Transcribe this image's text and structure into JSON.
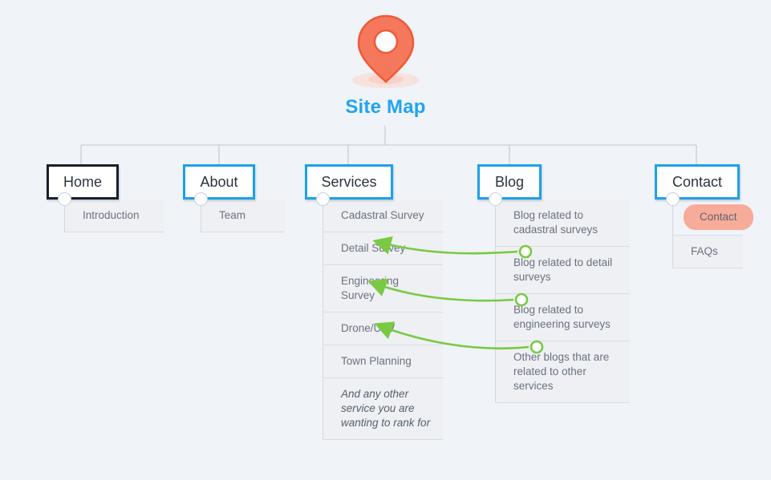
{
  "page": {
    "title": "Site Map",
    "background_color": "#f0f3f8",
    "title_color": "#1fa5f0",
    "accent_blue": "#1ba1e8",
    "accent_dark": "#16202e",
    "accent_green": "#7ac943",
    "accent_salmon": "#f7ab99",
    "pin_icon": "map-pin-icon"
  },
  "columns": [
    {
      "id": "home",
      "label": "Home",
      "selected": true,
      "children": [
        {
          "label": "Introduction",
          "highlight": false,
          "italic": false
        }
      ]
    },
    {
      "id": "about",
      "label": "About",
      "selected": false,
      "children": [
        {
          "label": "Team",
          "highlight": false,
          "italic": false
        }
      ]
    },
    {
      "id": "services",
      "label": "Services",
      "selected": false,
      "children": [
        {
          "label": "Cadastral Survey",
          "highlight": false,
          "italic": false
        },
        {
          "label": "Detail Survey",
          "highlight": false,
          "italic": false
        },
        {
          "label": "Engineering Survey",
          "highlight": false,
          "italic": false
        },
        {
          "label": "Drone/UAV",
          "highlight": false,
          "italic": false
        },
        {
          "label": "Town Planning",
          "highlight": false,
          "italic": false
        },
        {
          "label": "And any other service you are wanting to rank for",
          "highlight": false,
          "italic": true
        }
      ]
    },
    {
      "id": "blog",
      "label": "Blog",
      "selected": false,
      "children": [
        {
          "label": "Blog related to cadastral surveys",
          "highlight": false,
          "italic": false
        },
        {
          "label": "Blog related to detail surveys",
          "highlight": false,
          "italic": false
        },
        {
          "label": "Blog related to engineering surveys",
          "highlight": false,
          "italic": false
        },
        {
          "label": "Other blogs that are related to other services",
          "highlight": false,
          "italic": false
        }
      ]
    },
    {
      "id": "contact",
      "label": "Contact",
      "selected": false,
      "children": [
        {
          "label": "Contact",
          "highlight": true,
          "italic": false
        },
        {
          "label": "FAQs",
          "highlight": false,
          "italic": false
        }
      ]
    }
  ],
  "links": [
    {
      "from": "blog-cadastral-surveys",
      "to": "services-cadastral-survey"
    },
    {
      "from": "blog-detail-surveys",
      "to": "services-detail-survey"
    },
    {
      "from": "blog-engineering-surveys",
      "to": "services-engineering-survey"
    }
  ]
}
